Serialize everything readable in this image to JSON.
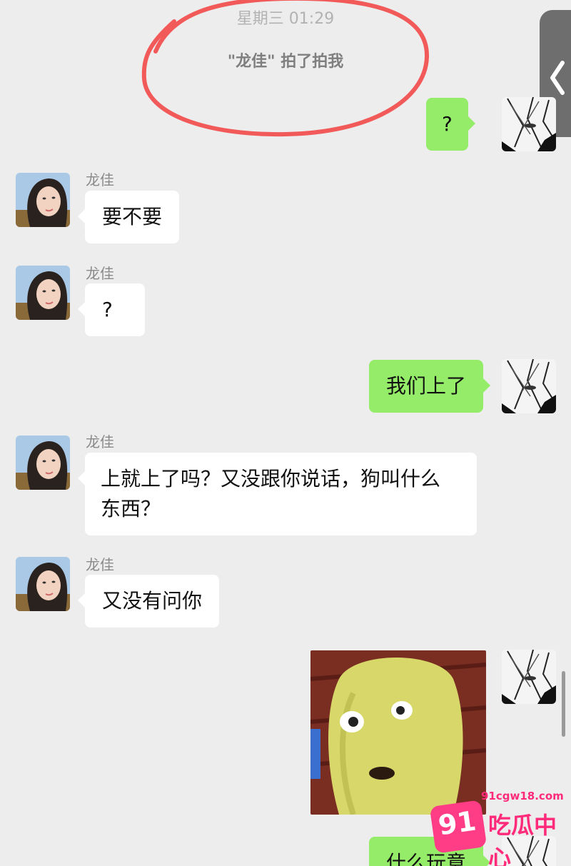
{
  "system": {
    "timestamp": "星期三 01:29",
    "pat_notice": "\"龙佳\" 拍了拍我"
  },
  "messages": [
    {
      "sender": "me",
      "text": "?"
    },
    {
      "sender_name": "龙佳",
      "text": "要不要"
    },
    {
      "sender_name": "龙佳",
      "text": "?"
    },
    {
      "sender": "me",
      "text": "我们上了"
    },
    {
      "sender_name": "龙佳",
      "text_line1": "上就上了吗？又没跟你说话，狗叫什么",
      "text_line2": "东西？"
    },
    {
      "sender_name": "龙佳",
      "text": "又没有问你"
    },
    {
      "sender": "me",
      "type": "sticker"
    },
    {
      "sender": "me",
      "text": "什么玩意"
    }
  ],
  "watermark": {
    "url": "91cgw18.com",
    "logo_number": "91",
    "text": "吃瓜中心"
  },
  "colors": {
    "background": "#ededed",
    "outgoing_bubble": "#95ec69",
    "incoming_bubble": "#ffffff",
    "annotation_circle": "#f25a5a",
    "watermark": "#ff2a7a"
  }
}
